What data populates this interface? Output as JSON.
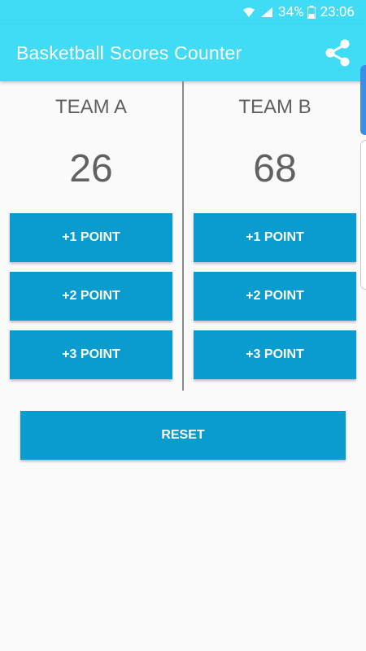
{
  "status_bar": {
    "battery": "34%",
    "time": "23:06"
  },
  "app_bar": {
    "title": "Basketball Scores Counter",
    "share_icon": "share-icon"
  },
  "team_a": {
    "name": "TEAM A",
    "score": "26",
    "buttons": [
      "+1 POINT",
      "+2 POINT",
      "+3 POINT"
    ]
  },
  "team_b": {
    "name": "TEAM B",
    "score": "68",
    "buttons": [
      "+1 POINT",
      "+2 POINT",
      "+3 POINT"
    ]
  },
  "reset_label": "RESET",
  "colors": {
    "primary": "#40dcf5",
    "button": "#0a9ccf",
    "text": "#616161",
    "background": "#fafafa"
  }
}
